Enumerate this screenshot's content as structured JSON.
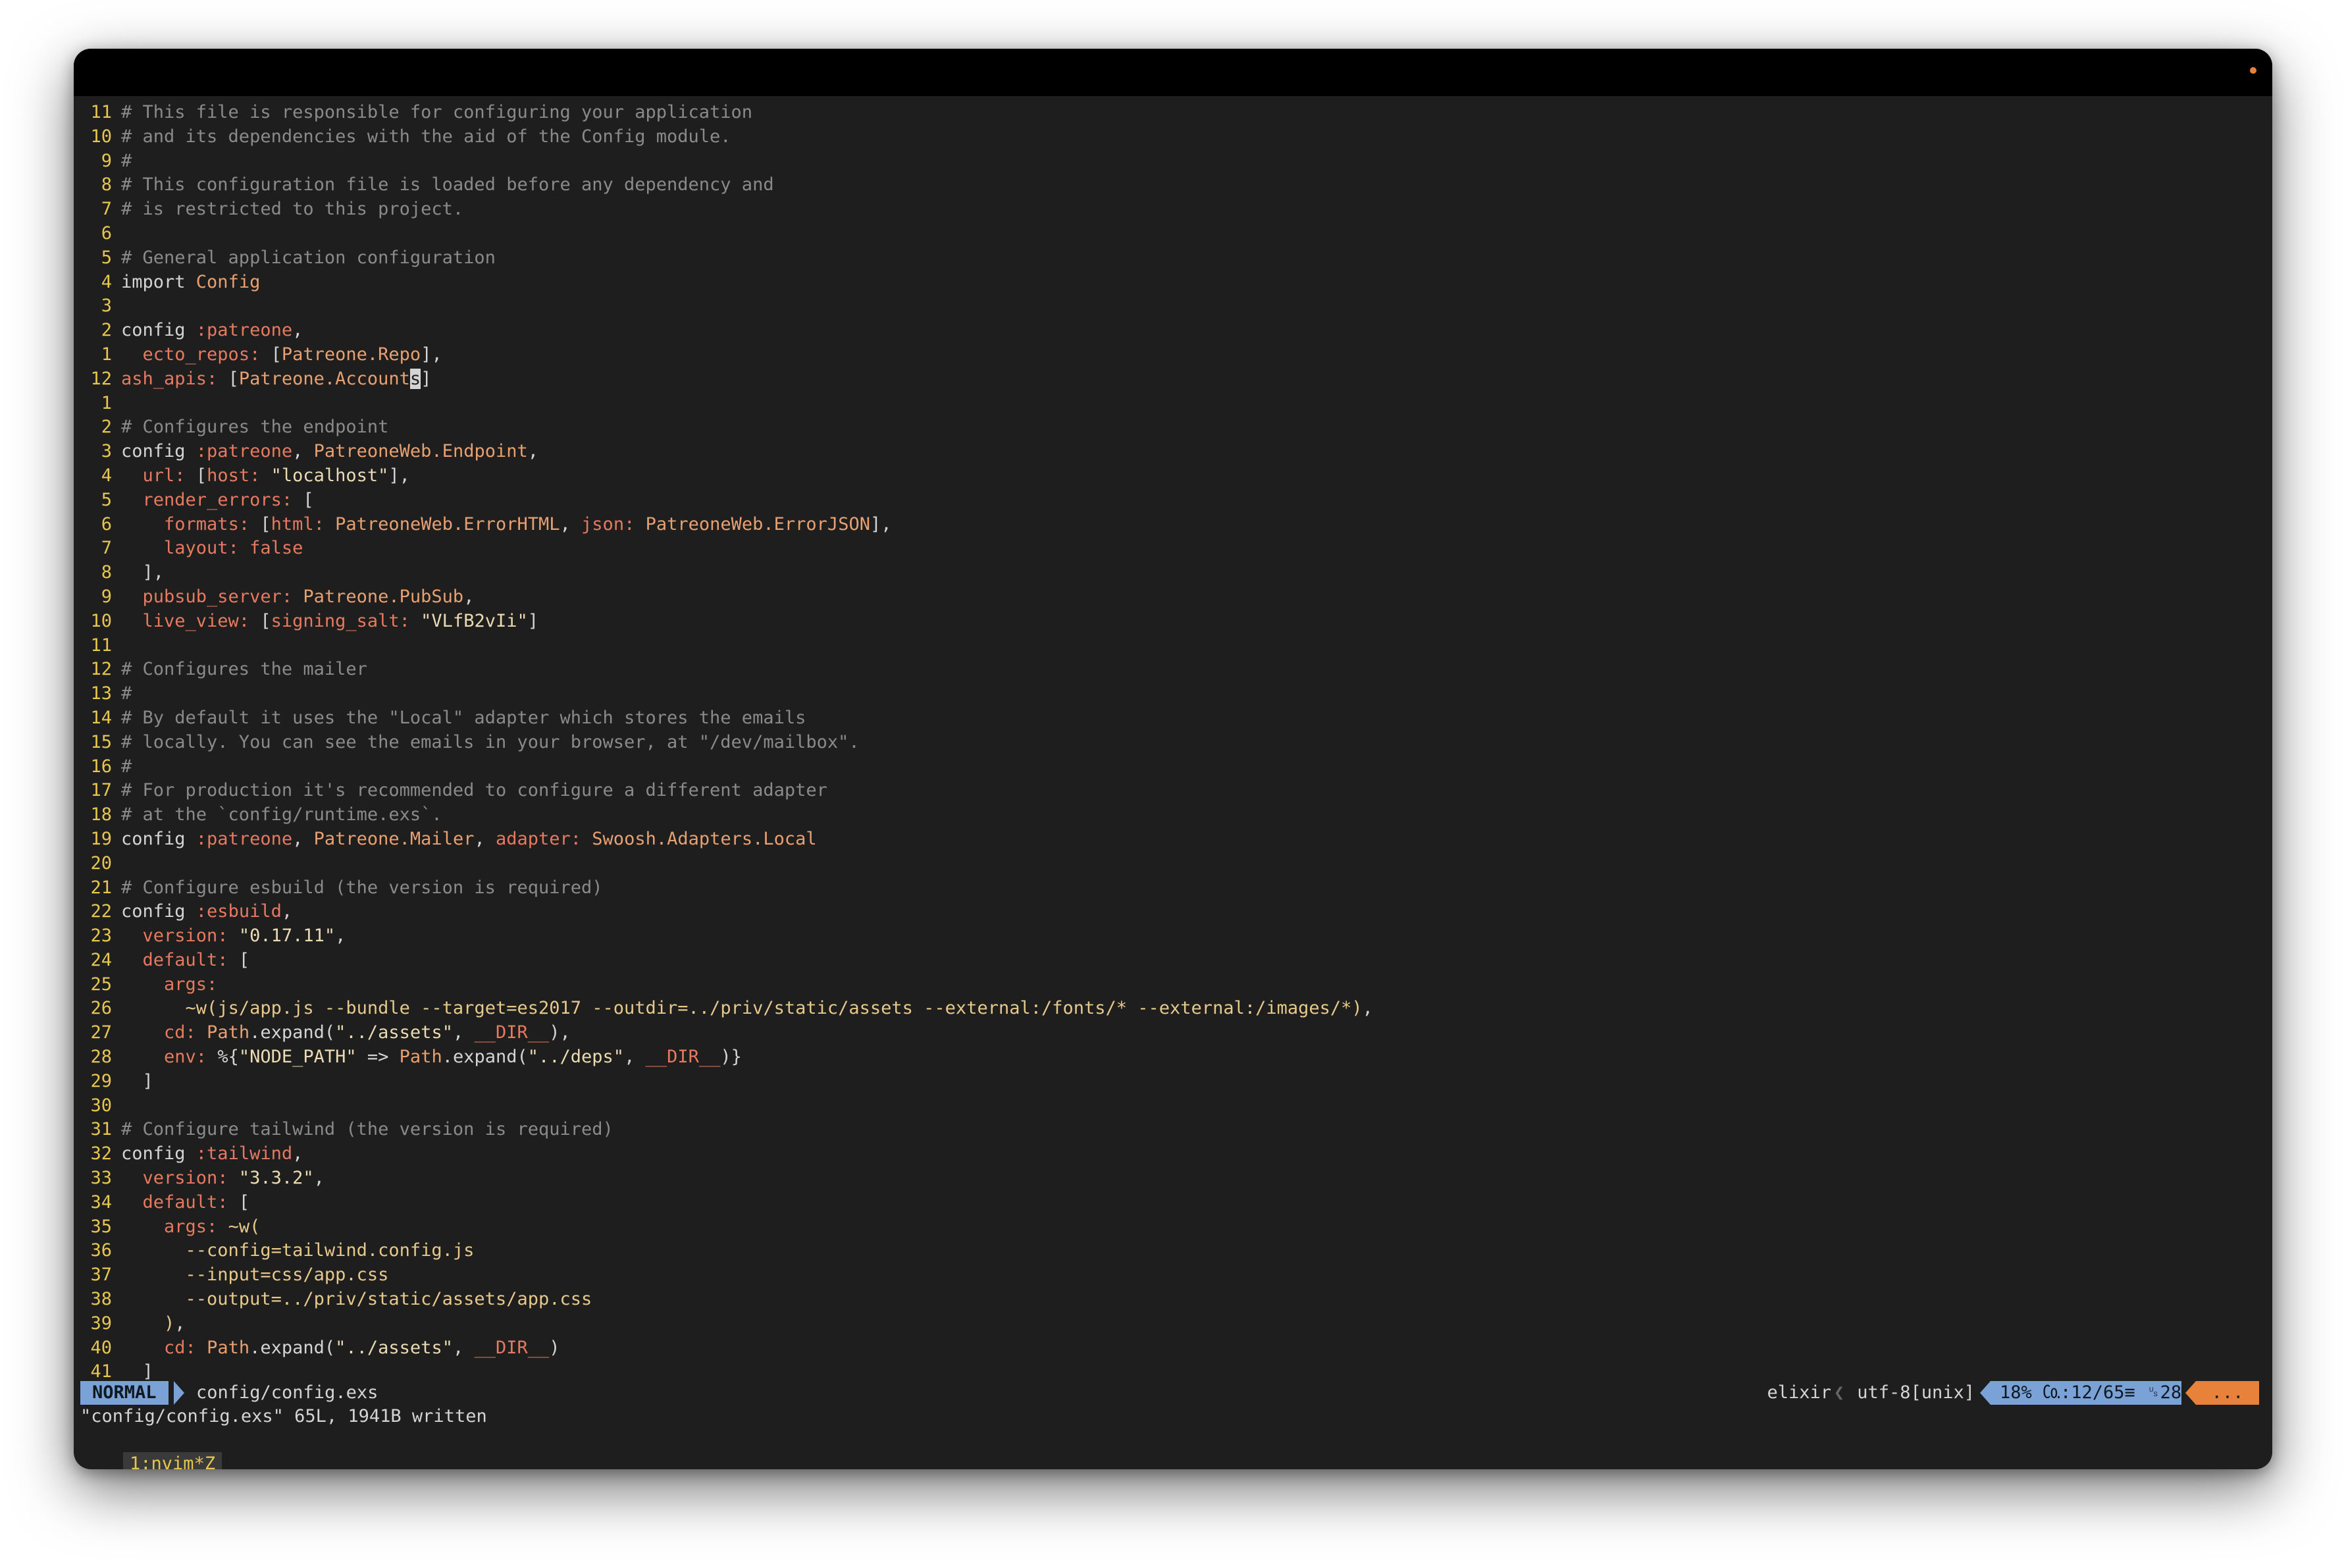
{
  "editor": {
    "lines": [
      {
        "n": "11",
        "parts": [
          [
            "comment",
            "# This file is responsible for configuring your application"
          ]
        ]
      },
      {
        "n": "10",
        "parts": [
          [
            "comment",
            "# and its dependencies with the aid of the Config module."
          ]
        ]
      },
      {
        "n": "9",
        "parts": [
          [
            "comment",
            "#"
          ]
        ]
      },
      {
        "n": "8",
        "parts": [
          [
            "comment",
            "# This configuration file is loaded before any dependency and"
          ]
        ]
      },
      {
        "n": "7",
        "parts": [
          [
            "comment",
            "# is restricted to this project."
          ]
        ]
      },
      {
        "n": "6",
        "parts": []
      },
      {
        "n": "5",
        "parts": [
          [
            "comment",
            "# General application configuration"
          ]
        ]
      },
      {
        "n": "4",
        "parts": [
          [
            "keyword",
            "import "
          ],
          [
            "module",
            "Config"
          ]
        ]
      },
      {
        "n": "3",
        "parts": []
      },
      {
        "n": "2",
        "parts": [
          [
            "keyword",
            "config "
          ],
          [
            "atom",
            ":patreone"
          ],
          [
            "plain",
            ","
          ]
        ]
      },
      {
        "n": "1",
        "parts": [
          [
            "plain",
            "  "
          ],
          [
            "key",
            "ecto_repos: "
          ],
          [
            "plain",
            "["
          ],
          [
            "module",
            "Patreone.Repo"
          ],
          [
            "plain",
            "],"
          ]
        ]
      },
      {
        "n": "12",
        "current": true,
        "parts": [
          [
            "key",
            "ash_apis: "
          ],
          [
            "plain",
            "["
          ],
          [
            "module",
            "Patreone.Account"
          ],
          [
            "cursor",
            "s"
          ],
          [
            "plain",
            "]"
          ]
        ]
      },
      {
        "n": "1",
        "parts": []
      },
      {
        "n": "2",
        "parts": [
          [
            "comment",
            "# Configures the endpoint"
          ]
        ]
      },
      {
        "n": "3",
        "parts": [
          [
            "keyword",
            "config "
          ],
          [
            "atom",
            ":patreone"
          ],
          [
            "plain",
            ", "
          ],
          [
            "module",
            "PatreoneWeb.Endpoint"
          ],
          [
            "plain",
            ","
          ]
        ]
      },
      {
        "n": "4",
        "parts": [
          [
            "plain",
            "  "
          ],
          [
            "key",
            "url: "
          ],
          [
            "plain",
            "["
          ],
          [
            "key",
            "host: "
          ],
          [
            "string",
            "\"localhost\""
          ],
          [
            "plain",
            "],"
          ]
        ]
      },
      {
        "n": "5",
        "parts": [
          [
            "plain",
            "  "
          ],
          [
            "key",
            "render_errors: "
          ],
          [
            "plain",
            "["
          ]
        ]
      },
      {
        "n": "6",
        "parts": [
          [
            "plain",
            "    "
          ],
          [
            "key",
            "formats: "
          ],
          [
            "plain",
            "["
          ],
          [
            "key",
            "html: "
          ],
          [
            "module",
            "PatreoneWeb.ErrorHTML"
          ],
          [
            "plain",
            ", "
          ],
          [
            "key",
            "json: "
          ],
          [
            "module",
            "PatreoneWeb.ErrorJSON"
          ],
          [
            "plain",
            "],"
          ]
        ]
      },
      {
        "n": "7",
        "parts": [
          [
            "plain",
            "    "
          ],
          [
            "key",
            "layout: "
          ],
          [
            "atom",
            "false"
          ]
        ]
      },
      {
        "n": "8",
        "parts": [
          [
            "plain",
            "  ],"
          ]
        ]
      },
      {
        "n": "9",
        "parts": [
          [
            "plain",
            "  "
          ],
          [
            "key",
            "pubsub_server: "
          ],
          [
            "module",
            "Patreone.PubSub"
          ],
          [
            "plain",
            ","
          ]
        ]
      },
      {
        "n": "10",
        "parts": [
          [
            "plain",
            "  "
          ],
          [
            "key",
            "live_view: "
          ],
          [
            "plain",
            "["
          ],
          [
            "key",
            "signing_salt: "
          ],
          [
            "string",
            "\"VLfB2vIi\""
          ],
          [
            "plain",
            "]"
          ]
        ]
      },
      {
        "n": "11",
        "parts": []
      },
      {
        "n": "12",
        "parts": [
          [
            "comment",
            "# Configures the mailer"
          ]
        ]
      },
      {
        "n": "13",
        "parts": [
          [
            "comment",
            "#"
          ]
        ]
      },
      {
        "n": "14",
        "parts": [
          [
            "comment",
            "# By default it uses the \"Local\" adapter which stores the emails"
          ]
        ]
      },
      {
        "n": "15",
        "parts": [
          [
            "comment",
            "# locally. You can see the emails in your browser, at \"/dev/mailbox\"."
          ]
        ]
      },
      {
        "n": "16",
        "parts": [
          [
            "comment",
            "#"
          ]
        ]
      },
      {
        "n": "17",
        "parts": [
          [
            "comment",
            "# For production it's recommended to configure a different adapter"
          ]
        ]
      },
      {
        "n": "18",
        "parts": [
          [
            "comment",
            "# at the `config/runtime.exs`."
          ]
        ]
      },
      {
        "n": "19",
        "parts": [
          [
            "keyword",
            "config "
          ],
          [
            "atom",
            ":patreone"
          ],
          [
            "plain",
            ", "
          ],
          [
            "module",
            "Patreone.Mailer"
          ],
          [
            "plain",
            ", "
          ],
          [
            "key",
            "adapter: "
          ],
          [
            "module",
            "Swoosh.Adapters.Local"
          ]
        ]
      },
      {
        "n": "20",
        "parts": []
      },
      {
        "n": "21",
        "parts": [
          [
            "comment",
            "# Configure esbuild (the version is required)"
          ]
        ]
      },
      {
        "n": "22",
        "parts": [
          [
            "keyword",
            "config "
          ],
          [
            "atom",
            ":esbuild"
          ],
          [
            "plain",
            ","
          ]
        ]
      },
      {
        "n": "23",
        "parts": [
          [
            "plain",
            "  "
          ],
          [
            "key",
            "version: "
          ],
          [
            "string",
            "\"0.17.11\""
          ],
          [
            "plain",
            ","
          ]
        ]
      },
      {
        "n": "24",
        "parts": [
          [
            "plain",
            "  "
          ],
          [
            "key",
            "default: "
          ],
          [
            "plain",
            "["
          ]
        ]
      },
      {
        "n": "25",
        "parts": [
          [
            "plain",
            "    "
          ],
          [
            "key",
            "args:"
          ]
        ]
      },
      {
        "n": "26",
        "parts": [
          [
            "plain",
            "      "
          ],
          [
            "sigil",
            "~w(js/app.js --bundle --target=es2017 --outdir=../priv/static/assets --external:/fonts/* --external:/images/*)"
          ],
          [
            "plain",
            ","
          ]
        ]
      },
      {
        "n": "27",
        "parts": [
          [
            "plain",
            "    "
          ],
          [
            "key",
            "cd: "
          ],
          [
            "module",
            "Path"
          ],
          [
            "plain",
            ".expand("
          ],
          [
            "string",
            "\"../assets\""
          ],
          [
            "plain",
            ", "
          ],
          [
            "atom",
            "__DIR__"
          ],
          [
            "plain",
            "),"
          ]
        ]
      },
      {
        "n": "28",
        "parts": [
          [
            "plain",
            "    "
          ],
          [
            "key",
            "env: "
          ],
          [
            "plain",
            "%{"
          ],
          [
            "string",
            "\"NODE_PATH\""
          ],
          [
            "plain",
            " => "
          ],
          [
            "module",
            "Path"
          ],
          [
            "plain",
            ".expand("
          ],
          [
            "string",
            "\"../deps\""
          ],
          [
            "plain",
            ", "
          ],
          [
            "atom",
            "__DIR__"
          ],
          [
            "plain",
            ")}"
          ]
        ]
      },
      {
        "n": "29",
        "parts": [
          [
            "plain",
            "  ]"
          ]
        ]
      },
      {
        "n": "30",
        "parts": []
      },
      {
        "n": "31",
        "parts": [
          [
            "comment",
            "# Configure tailwind (the version is required)"
          ]
        ]
      },
      {
        "n": "32",
        "parts": [
          [
            "keyword",
            "config "
          ],
          [
            "atom",
            ":tailwind"
          ],
          [
            "plain",
            ","
          ]
        ]
      },
      {
        "n": "33",
        "parts": [
          [
            "plain",
            "  "
          ],
          [
            "key",
            "version: "
          ],
          [
            "string",
            "\"3.3.2\""
          ],
          [
            "plain",
            ","
          ]
        ]
      },
      {
        "n": "34",
        "parts": [
          [
            "plain",
            "  "
          ],
          [
            "key",
            "default: "
          ],
          [
            "plain",
            "["
          ]
        ]
      },
      {
        "n": "35",
        "parts": [
          [
            "plain",
            "    "
          ],
          [
            "key",
            "args: "
          ],
          [
            "sigil",
            "~w("
          ]
        ]
      },
      {
        "n": "36",
        "parts": [
          [
            "sigil",
            "      --config=tailwind.config.js"
          ]
        ]
      },
      {
        "n": "37",
        "parts": [
          [
            "sigil",
            "      --input=css/app.css"
          ]
        ]
      },
      {
        "n": "38",
        "parts": [
          [
            "sigil",
            "      --output=../priv/static/assets/app.css"
          ]
        ]
      },
      {
        "n": "39",
        "parts": [
          [
            "sigil",
            "    )"
          ],
          [
            "plain",
            ","
          ]
        ]
      },
      {
        "n": "40",
        "parts": [
          [
            "plain",
            "    "
          ],
          [
            "key",
            "cd: "
          ],
          [
            "module",
            "Path"
          ],
          [
            "plain",
            ".expand("
          ],
          [
            "string",
            "\"../assets\""
          ],
          [
            "plain",
            ", "
          ],
          [
            "atom",
            "__DIR__"
          ],
          [
            "plain",
            ")"
          ]
        ]
      },
      {
        "n": "41",
        "parts": [
          [
            "plain",
            "  ]"
          ]
        ]
      }
    ]
  },
  "statusline": {
    "mode": "NORMAL",
    "filename": "config/config.exs",
    "filetype": "elixir",
    "encoding": "utf-8[unix]",
    "position": "18% ㏇:12/65≡ ␟28",
    "warnings": "..."
  },
  "message": "\"config/config.exs\" 65L, 1941B written",
  "tmux": {
    "window": "1:nvim*Z"
  },
  "colors": {
    "mode_bg": "#7aa2d6",
    "warn_bg": "#e8823a",
    "line_number": "#e6c64f",
    "comment": "#8a8a8a",
    "atom": "#e6795f",
    "module": "#e8a070"
  }
}
